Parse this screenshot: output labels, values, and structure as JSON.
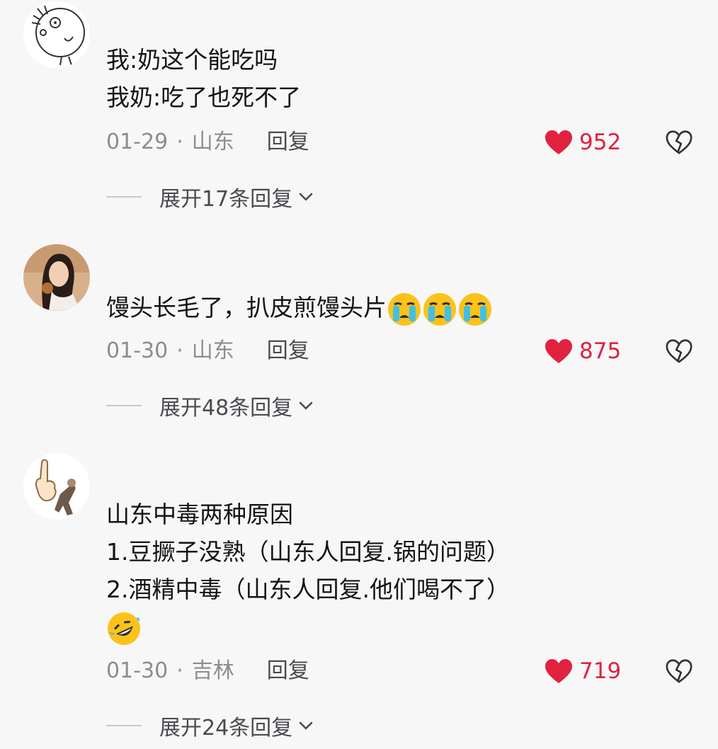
{
  "comments": [
    {
      "avatar": "hand-drawn-face-avatar",
      "lines": [
        "我:奶这个能吃吗",
        "我奶:吃了也死不了"
      ],
      "date": "01-29",
      "separator": "·",
      "location": "山东",
      "reply_label": "回复",
      "likes": "952",
      "expand_label": "展开17条回复"
    },
    {
      "avatar": "woman-photo-avatar",
      "lines": [
        "馒头长毛了，扒皮煎馒头片"
      ],
      "trailing_emojis": [
        "crying-emoji",
        "crying-emoji",
        "crying-emoji"
      ],
      "date": "01-30",
      "separator": "·",
      "location": "山东",
      "reply_label": "回复",
      "likes": "875",
      "expand_label": "展开48条回复"
    },
    {
      "avatar": "finger-cartoon-avatar",
      "lines": [
        "山东中毒两种原因",
        "1.豆撅子没熟（山东人回复.锅的问题）",
        "2.酒精中毒（山东人回复.他们喝不了）"
      ],
      "trailing_emojis": [
        "rolling-laugh-emoji"
      ],
      "date": "01-30",
      "separator": "·",
      "location": "吉林",
      "reply_label": "回复",
      "likes": "719",
      "expand_label": "展开24条回复"
    }
  ],
  "colors": {
    "background": "#f7f7f8",
    "like_red": "#e0223f",
    "meta_gray": "#8c8c91",
    "reply_gray": "#4a4a4f"
  }
}
